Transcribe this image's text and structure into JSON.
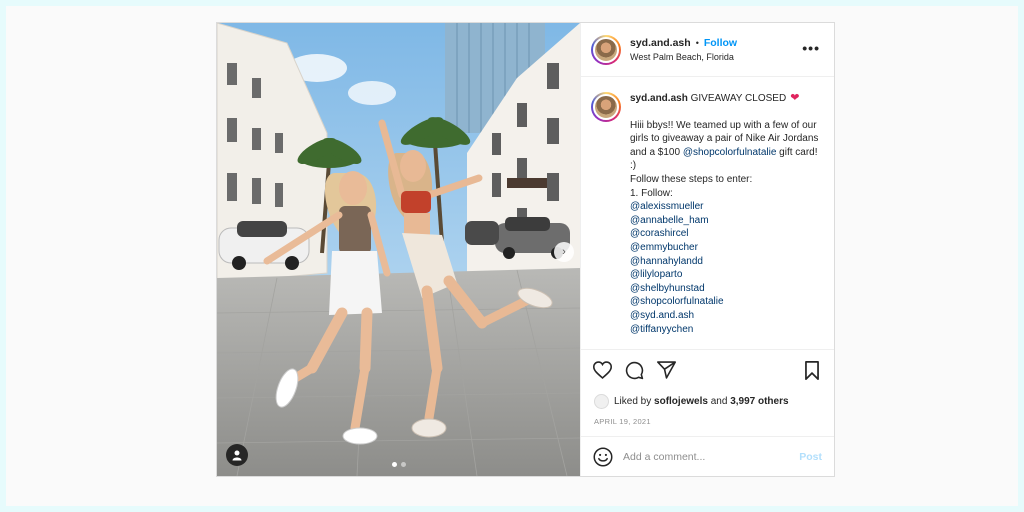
{
  "post": {
    "username": "syd.and.ash",
    "follow_label": "Follow",
    "separator": "•",
    "location": "West Palm Beach, Florida",
    "more_label": "•••",
    "caption": {
      "username": "syd.and.ash",
      "title": "GIVEAWAY CLOSED",
      "heart": "❤",
      "intro": "Hiii bbys!! We teamed up with a few of our girls to giveaway a pair of Nike Air Jordans and a $100",
      "intro_mention": "@shopcolorfulnatalie",
      "intro_tail": "gift card! :)",
      "steps_line": "Follow these steps to enter:",
      "step1": "1. Follow:",
      "mentions": [
        "@alexissmueller",
        "@annabelle_ham",
        "@corashircel",
        "@emmybucher",
        "@hannahylandd",
        "@lilyloparto",
        "@shelbyhunstad",
        "@shopcolorfulnatalie",
        "@syd.and.ash",
        "@tiffanyychen"
      ]
    },
    "likes": {
      "prefix": "Liked by",
      "user": "soflojewels",
      "and": "and",
      "others": "3,997 others"
    },
    "date": "APRIL 19, 2021",
    "comment": {
      "placeholder": "Add a comment...",
      "post_label": "Post"
    },
    "carousel": {
      "next_icon": "›",
      "dots": 2,
      "active_dot": 0
    }
  },
  "colors": {
    "page_bg": "#e6fbfc",
    "link": "#00376b",
    "follow": "#0095f6",
    "post_disabled": "#b2dffc"
  }
}
